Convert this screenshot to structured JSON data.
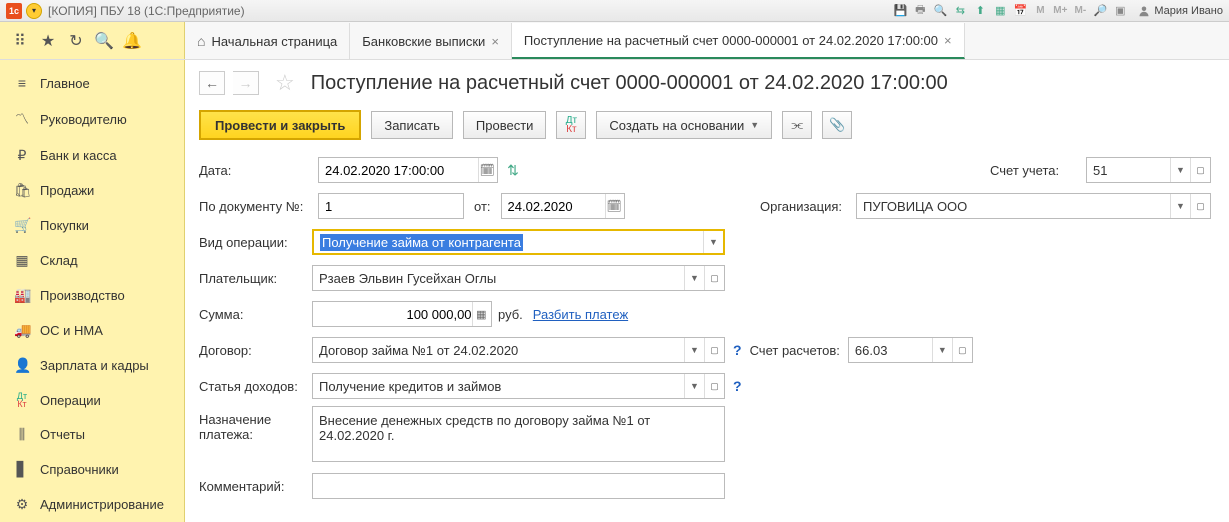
{
  "titlebar": {
    "title": "[КОПИЯ] ПБУ 18  (1С:Предприятие)",
    "user": "Мария Ивано"
  },
  "tabs": {
    "home": "Начальная страница",
    "t1": "Банковские выписки",
    "t2": "Поступление на расчетный счет 0000-000001 от 24.02.2020 17:00:00"
  },
  "sidebar": {
    "items": [
      "Главное",
      "Руководителю",
      "Банк и касса",
      "Продажи",
      "Покупки",
      "Склад",
      "Производство",
      "ОС и НМА",
      "Зарплата и кадры",
      "Операции",
      "Отчеты",
      "Справочники",
      "Администрирование"
    ]
  },
  "page": {
    "title": "Поступление на расчетный счет 0000-000001 от 24.02.2020 17:00:00"
  },
  "actions": {
    "primary": "Провести и закрыть",
    "write": "Записать",
    "post": "Провести",
    "createBased": "Создать на основании"
  },
  "labels": {
    "date": "Дата:",
    "docNo": "По документу №:",
    "from": "от:",
    "opType": "Вид операции:",
    "payer": "Плательщик:",
    "sum": "Сумма:",
    "unit": "руб.",
    "split": "Разбить платеж",
    "contract": "Договор:",
    "incomeItem": "Статья доходов:",
    "purpose": "Назначение платежа:",
    "comment": "Комментарий:",
    "account": "Счет учета:",
    "org": "Организация:",
    "settleAcc": "Счет расчетов:"
  },
  "values": {
    "date": "24.02.2020 17:00:00",
    "docNo": "1",
    "docDate": "24.02.2020",
    "opType": "Получение займа от контрагента",
    "payer": "Рзаев Эльвин Гусейхан Оглы",
    "sum": "100 000,00",
    "contract": "Договор займа №1 от 24.02.2020",
    "incomeItem": "Получение кредитов и займов",
    "purpose": "Внесение денежных средств по договору займа №1 от 24.02.2020 г.",
    "comment": "",
    "account": "51",
    "org": "ПУГОВИЦА ООО",
    "settleAcc": "66.03"
  }
}
